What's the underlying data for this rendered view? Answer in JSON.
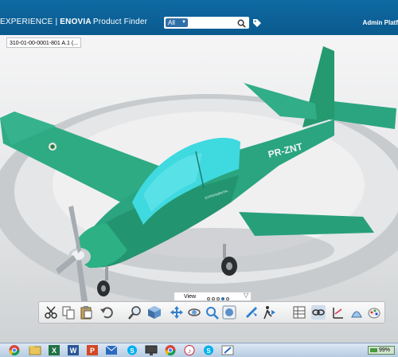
{
  "header": {
    "brand_prefix": "EXPERIENCE",
    "brand_separator": "|",
    "brand_app": "ENOVIA",
    "brand_module": "Product Finder",
    "search_scope": "All",
    "search_placeholder": "",
    "user_name": "Admin Platf"
  },
  "tab": {
    "label": "310-01-00-0001-801 A.1 (..."
  },
  "model": {
    "registration": "PR-ZNT",
    "fuselage_text": "EXPERIMENTAL",
    "color_body": "#2aa57f",
    "color_canopy": "#3fd9e0"
  },
  "view_strip": {
    "label": "View",
    "dots": 5,
    "active_dot": 4
  },
  "toolbar": {
    "icons": [
      "cut-icon",
      "copy-icon",
      "paste-icon",
      "undo-icon",
      "zoom-icon",
      "view-cube-icon",
      "pan-icon",
      "rotate-icon",
      "zoom-area-icon",
      "render-style-icon",
      "fly-icon",
      "walk-icon",
      "measure-icon",
      "grid-icon",
      "link-icon",
      "axis-icon",
      "sectioning-icon",
      "palette-icon"
    ]
  },
  "taskbar": {
    "apps": [
      "chrome",
      "explorer",
      "excel",
      "word",
      "powerpoint",
      "outlook",
      "skype",
      "monitor",
      "chrome-2",
      "itunes",
      "skype-2",
      "paint"
    ],
    "battery": "99%"
  }
}
